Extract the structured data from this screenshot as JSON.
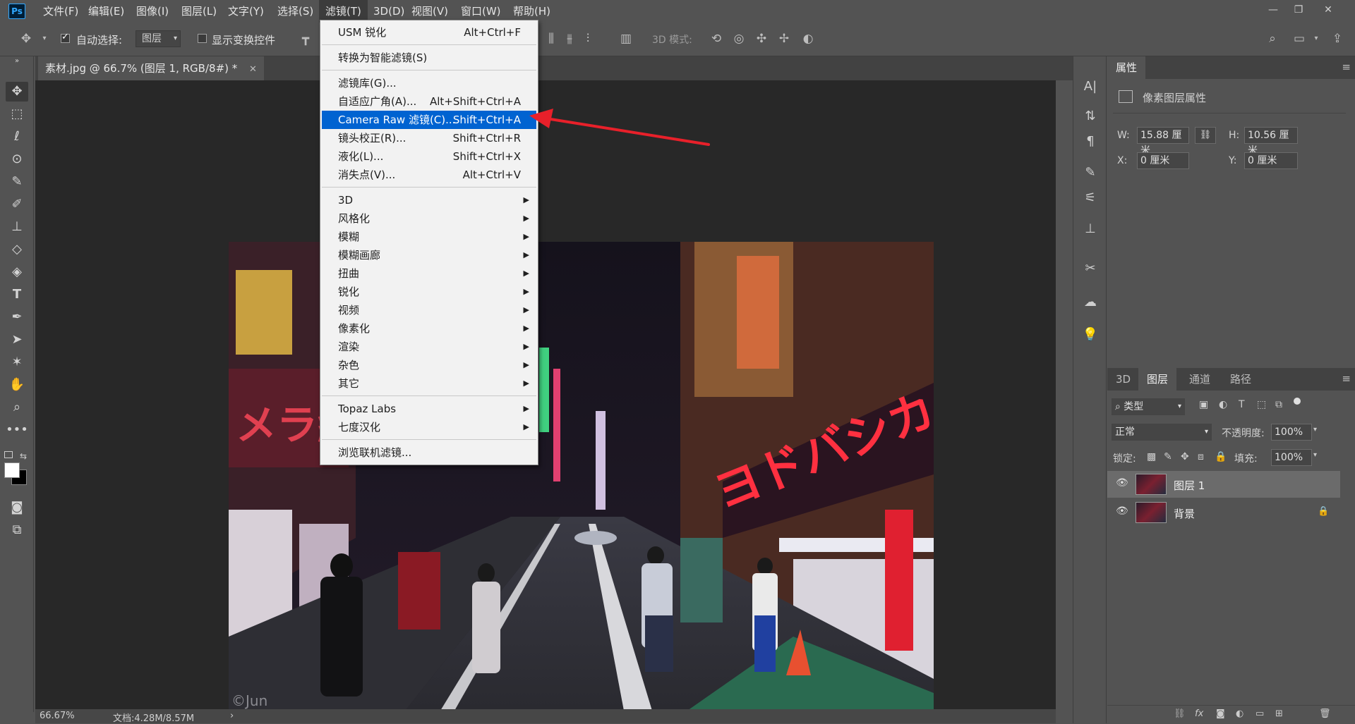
{
  "menubar": {
    "logo": "Ps",
    "items": [
      "文件(F)",
      "编辑(E)",
      "图像(I)",
      "图层(L)",
      "文字(Y)",
      "选择(S)",
      "滤镜(T)",
      "3D(D)",
      "视图(V)",
      "窗口(W)",
      "帮助(H)"
    ],
    "active_index": 6
  },
  "optbar": {
    "auto_select_label": "自动选择:",
    "auto_select_value": "图层",
    "show_transform_label": "显示变换控件",
    "mode_3d_label": "3D 模式:"
  },
  "document_tab": {
    "title": "素材.jpg @ 66.7% (图层 1, RGB/8#) *"
  },
  "watermark": "©Jun",
  "statusbar": {
    "zoom": "66.67%",
    "doc_info": "文档:4.28M/8.57M"
  },
  "filter_menu": {
    "items": [
      {
        "label": "USM 锐化",
        "shortcut": "Alt+Ctrl+F"
      },
      {
        "sep": true
      },
      {
        "label": "转换为智能滤镜(S)"
      },
      {
        "sep": true
      },
      {
        "label": "滤镜库(G)..."
      },
      {
        "label": "自适应广角(A)...",
        "shortcut": "Alt+Shift+Ctrl+A"
      },
      {
        "label": "Camera Raw 滤镜(C)...",
        "shortcut": "Shift+Ctrl+A",
        "highlighted": true
      },
      {
        "label": "镜头校正(R)...",
        "shortcut": "Shift+Ctrl+R"
      },
      {
        "label": "液化(L)...",
        "shortcut": "Shift+Ctrl+X"
      },
      {
        "label": "消失点(V)...",
        "shortcut": "Alt+Ctrl+V"
      },
      {
        "sep": true
      },
      {
        "label": "3D",
        "submenu": true
      },
      {
        "label": "风格化",
        "submenu": true
      },
      {
        "label": "模糊",
        "submenu": true
      },
      {
        "label": "模糊画廊",
        "submenu": true
      },
      {
        "label": "扭曲",
        "submenu": true
      },
      {
        "label": "锐化",
        "submenu": true
      },
      {
        "label": "视频",
        "submenu": true
      },
      {
        "label": "像素化",
        "submenu": true
      },
      {
        "label": "渲染",
        "submenu": true
      },
      {
        "label": "杂色",
        "submenu": true
      },
      {
        "label": "其它",
        "submenu": true
      },
      {
        "sep": true
      },
      {
        "label": "Topaz Labs",
        "submenu": true
      },
      {
        "label": "七度汉化",
        "submenu": true
      },
      {
        "sep": true
      },
      {
        "label": "浏览联机滤镜..."
      }
    ]
  },
  "properties": {
    "tab": "属性",
    "subtitle": "像素图层属性",
    "w_label": "W:",
    "w_value": "15.88 厘米",
    "h_label": "H:",
    "h_value": "10.56 厘米",
    "x_label": "X:",
    "x_value": "0 厘米",
    "y_label": "Y:",
    "y_value": "0 厘米"
  },
  "layers": {
    "tabs": [
      "3D",
      "图层",
      "通道",
      "路径"
    ],
    "active_tab": 1,
    "filter_type": "类型",
    "blend_mode": "正常",
    "opacity_label": "不透明度:",
    "opacity_value": "100%",
    "lock_label": "锁定:",
    "fill_label": "填充:",
    "fill_value": "100%",
    "items": [
      {
        "name": "图层 1",
        "selected": true
      },
      {
        "name": "背景",
        "locked": true
      }
    ]
  },
  "colors": {
    "menu_highlight": "#0063d1",
    "arrow": "#e8202a",
    "panel_bg": "#535353",
    "canvas_bg": "#282828"
  }
}
